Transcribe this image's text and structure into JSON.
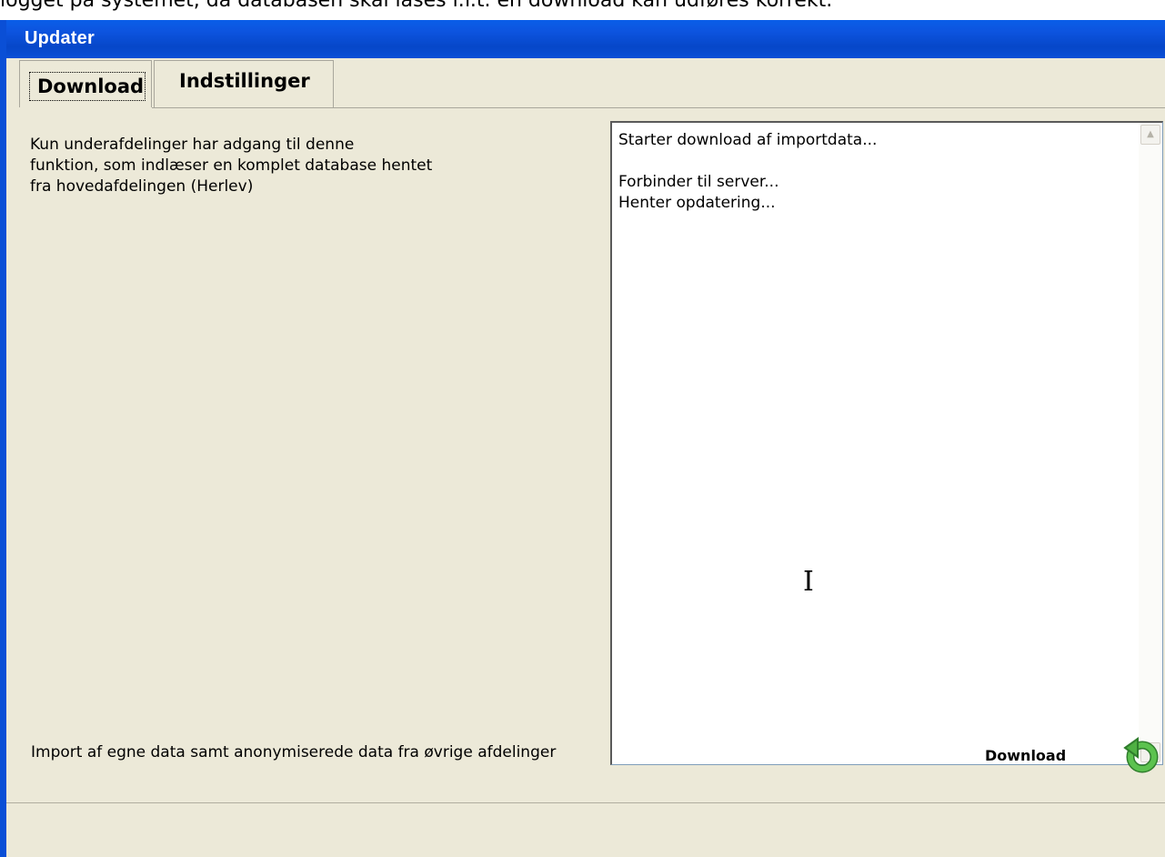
{
  "background_text": "logget på systemet, da databasen skal låses i.f.t. en download kan udføres korrekt.",
  "window": {
    "title": "Updater"
  },
  "tabs": [
    {
      "label": "Download",
      "active": true
    },
    {
      "label": "Indstillinger",
      "active": false
    }
  ],
  "description": [
    "Kun underafdelinger har adgang til denne",
    "funktion, som indlæser en komplet database hentet",
    "fra hovedafdelingen (Herlev)"
  ],
  "log": [
    "Starter download af importdata...",
    "",
    "Forbinder til server...",
    "Henter opdatering..."
  ],
  "footer": {
    "text": "Import af egne data samt  anonymiserede data fra øvrige afdelinger",
    "download_label": "Download"
  },
  "colors": {
    "titlebar": "#0a4fd6",
    "window_bg": "#ece9d8",
    "icon_green": "#3da33a"
  },
  "icons": {
    "refresh": "green-refresh-arrow-icon",
    "cursor": "text-cursor-icon"
  }
}
